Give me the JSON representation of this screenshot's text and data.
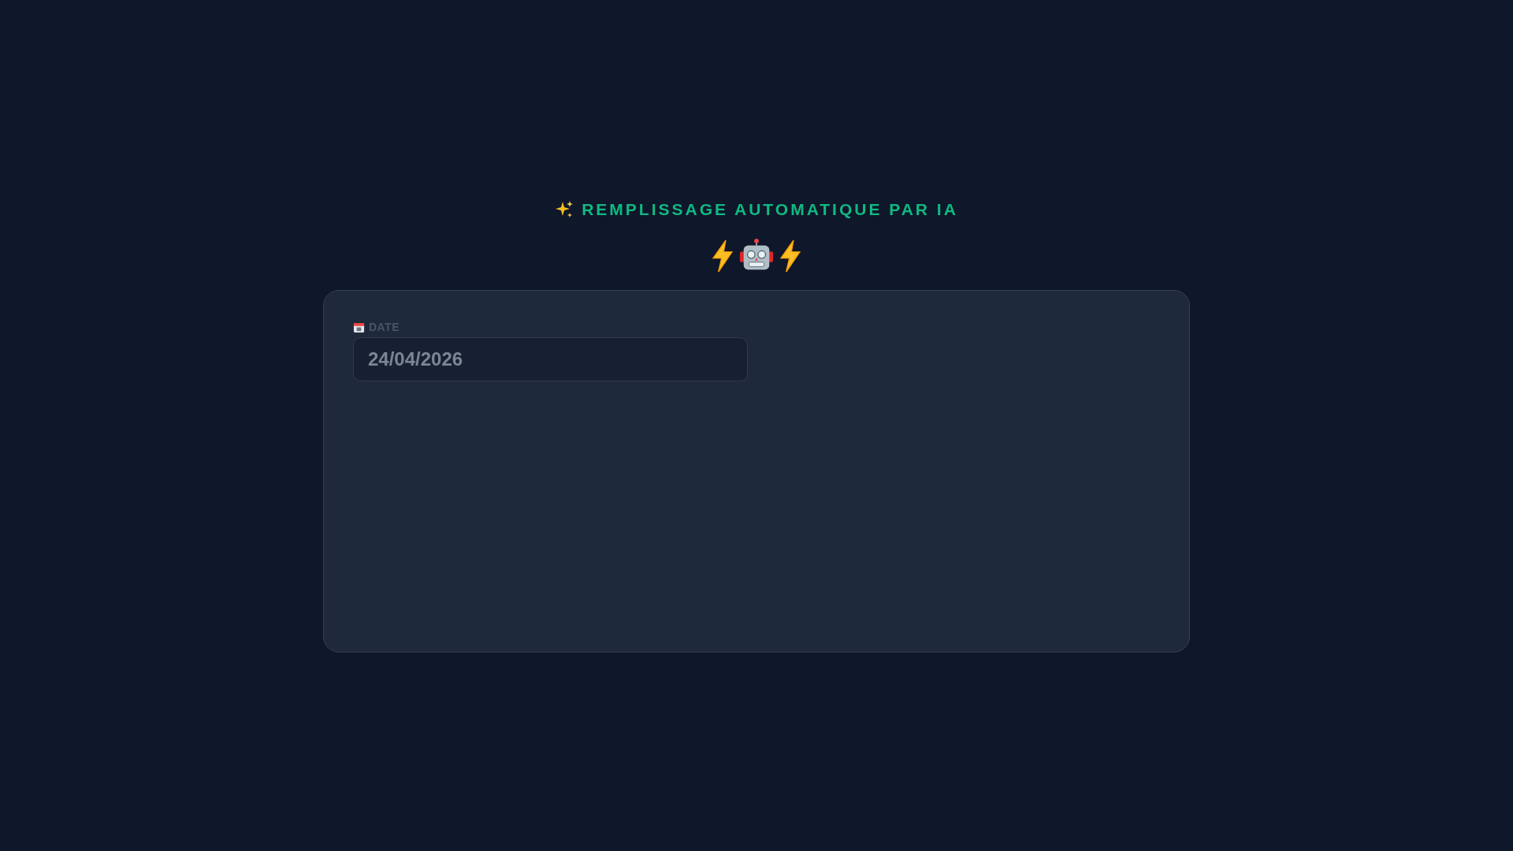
{
  "header": {
    "title": "REMPLISSAGE AUTOMATIQUE PAR IA"
  },
  "form": {
    "fields": [
      {
        "label": "DATE",
        "value": "24/04/2026"
      }
    ]
  }
}
